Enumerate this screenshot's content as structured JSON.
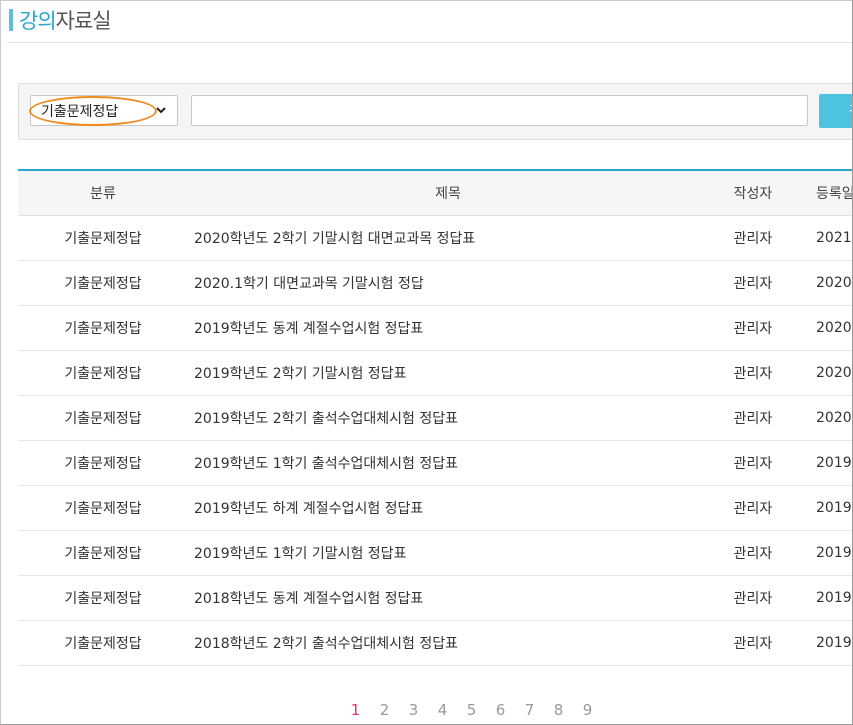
{
  "header": {
    "title_accent": "강의",
    "title_rest": "자료실"
  },
  "search": {
    "category_selected": "기출문제정답",
    "query_value": "",
    "button_label": "검"
  },
  "table": {
    "headers": [
      "분류",
      "제목",
      "작성자",
      "등록일"
    ],
    "rows": [
      {
        "category": "기출문제정답",
        "title": "2020학년도 2학기 기말시험 대면교과목 정답표",
        "author": "관리자",
        "date": "2021"
      },
      {
        "category": "기출문제정답",
        "title": "2020.1학기 대면교과목 기말시험 정답",
        "author": "관리자",
        "date": "2020"
      },
      {
        "category": "기출문제정답",
        "title": "2019학년도 동계 계절수업시험 정답표",
        "author": "관리자",
        "date": "2020"
      },
      {
        "category": "기출문제정답",
        "title": "2019학년도 2학기 기말시험 정답표",
        "author": "관리자",
        "date": "2020"
      },
      {
        "category": "기출문제정답",
        "title": "2019학년도 2학기 출석수업대체시험 정답표",
        "author": "관리자",
        "date": "2020"
      },
      {
        "category": "기출문제정답",
        "title": "2019학년도 1학기 출석수업대체시험 정답표",
        "author": "관리자",
        "date": "2019"
      },
      {
        "category": "기출문제정답",
        "title": "2019학년도 하계 계절수업시험 정답표",
        "author": "관리자",
        "date": "2019"
      },
      {
        "category": "기출문제정답",
        "title": "2019학년도 1학기 기말시험 정답표",
        "author": "관리자",
        "date": "2019"
      },
      {
        "category": "기출문제정답",
        "title": "2018학년도 동계 계절수업시험 정답표",
        "author": "관리자",
        "date": "2019"
      },
      {
        "category": "기출문제정답",
        "title": "2018학년도 2학기 출석수업대체시험 정답표",
        "author": "관리자",
        "date": "2019"
      }
    ]
  },
  "pagination": {
    "pages": [
      "1",
      "2",
      "3",
      "4",
      "5",
      "6",
      "7",
      "8",
      "9"
    ],
    "current": "1"
  },
  "colors": {
    "accent": "#2aa6d2",
    "button": "#4ec3df",
    "highlight_ring": "#f08a1c",
    "active_page": "#e2336d"
  },
  "icons": {
    "select_arrow": "chevron-down-icon"
  }
}
